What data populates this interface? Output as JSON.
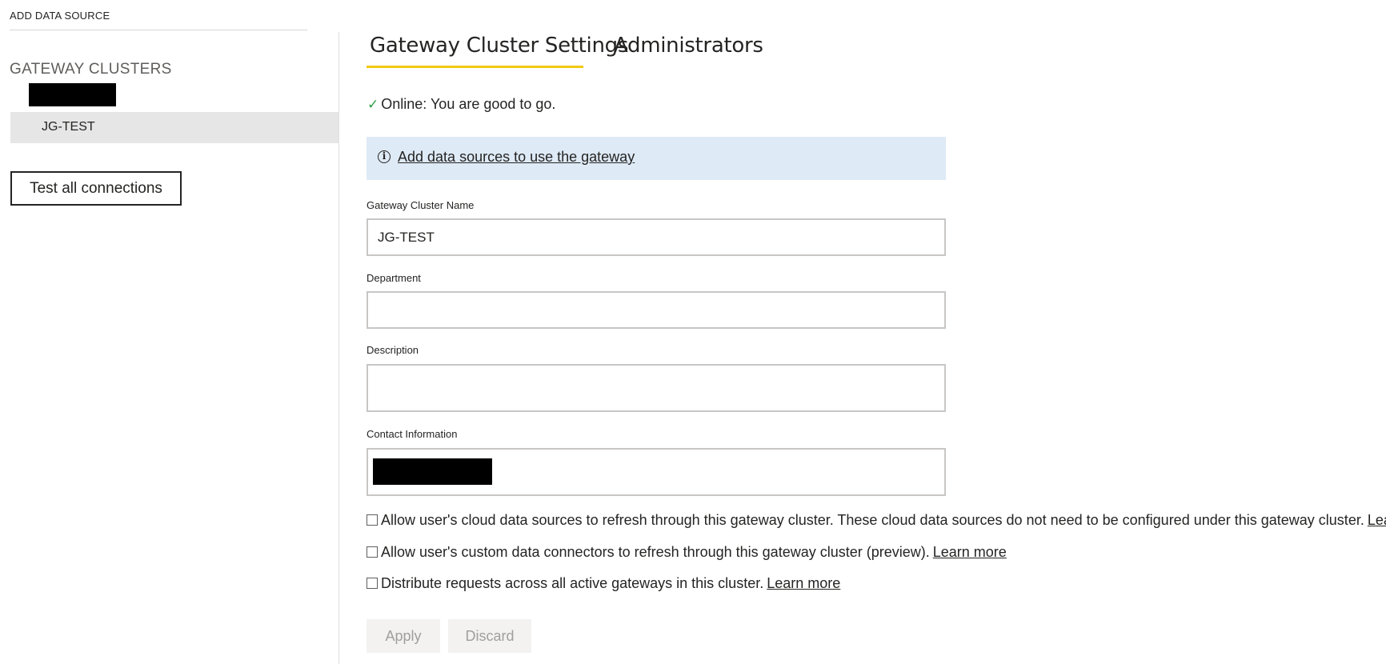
{
  "left_panel": {
    "add_data_source": "ADD DATA SOURCE",
    "clusters_heading": "GATEWAY CLUSTERS",
    "cluster_items": [
      {
        "label": "JG-TEST",
        "selected": true
      }
    ],
    "test_button": "Test all connections"
  },
  "tabs": [
    {
      "label": "Gateway Cluster Settings",
      "active": true
    },
    {
      "label": "Administrators",
      "active": false
    }
  ],
  "status": {
    "check": "✓",
    "text": "Online: You are good to go."
  },
  "banner": {
    "icon": "i",
    "link": "Add data sources to use the gateway"
  },
  "form": {
    "cluster_name_label": "Gateway Cluster Name",
    "cluster_name_value": "JG-TEST",
    "department_label": "Department",
    "department_value": "",
    "description_label": "Description",
    "description_value": "",
    "contact_label": "Contact Information",
    "contact_value": ""
  },
  "options": [
    {
      "text": "Allow user's cloud data sources to refresh through this gateway cluster. These cloud data sources do not need to be configured under this gateway cluster.",
      "link": "Learn more",
      "checked": false
    },
    {
      "text": "Allow user's custom data connectors to refresh through this gateway cluster (preview).",
      "link": "Learn more",
      "checked": false
    },
    {
      "text": "Distribute requests across all active gateways in this cluster.",
      "link": "Learn more",
      "checked": false
    }
  ],
  "actions": {
    "apply": "Apply",
    "discard": "Discard"
  },
  "colors": {
    "tab_accent": "#f2c811",
    "banner_bg": "#deeaf6",
    "status_ok": "#2f9e44",
    "selected_item_bg": "#e6e6e6"
  }
}
